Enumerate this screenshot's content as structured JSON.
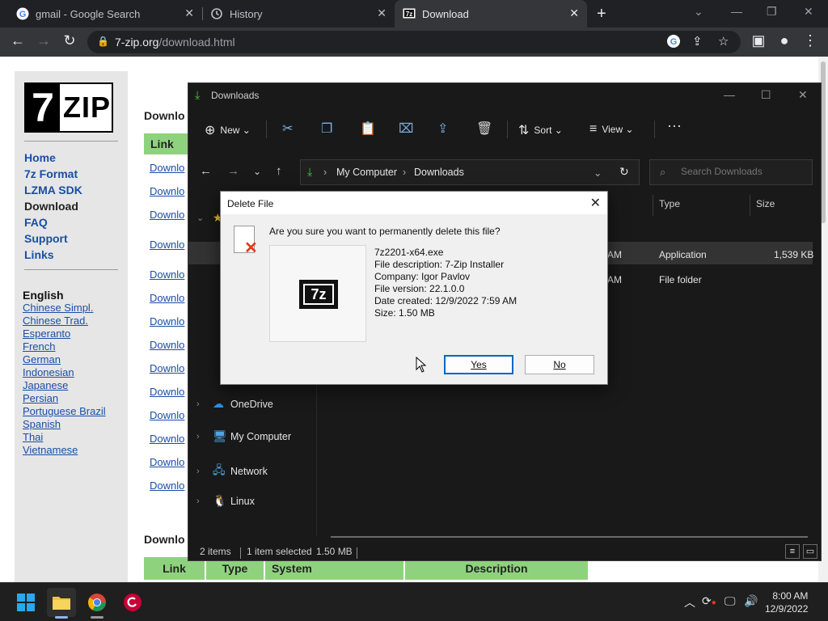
{
  "chrome": {
    "tabs": [
      {
        "title": "gmail - Google Search",
        "icon": "google-g-icon"
      },
      {
        "title": "History",
        "icon": "history-icon"
      },
      {
        "title": "Download",
        "icon": "7zip-favicon"
      }
    ],
    "url_host": "7-zip.org",
    "url_path": "/download.html"
  },
  "site": {
    "nav": [
      "Home",
      "7z Format",
      "LZMA SDK",
      "Download",
      "FAQ",
      "Support",
      "Links"
    ],
    "current_nav": "Download",
    "language_heading": "English",
    "languages": [
      "Chinese Simpl.",
      "Chinese Trad.",
      "Esperanto",
      "French",
      "German",
      "Indonesian",
      "Japanese",
      "Persian",
      "Portuguese Brazil",
      "Spanish",
      "Thai",
      "Vietnamese"
    ],
    "section_heading_1": "Downlo",
    "section_heading_2": "Downlo",
    "link_header": "Link",
    "download_link": "Downlo",
    "table_headers": [
      "Link",
      "Type",
      "System",
      "Description"
    ]
  },
  "explorer": {
    "title": "Downloads",
    "commands": {
      "new": "New",
      "sort": "Sort",
      "view": "View"
    },
    "breadcrumb": [
      "My Computer",
      "Downloads"
    ],
    "search_placeholder": "Search Downloads",
    "columns": {
      "type": "Type",
      "size": "Size"
    },
    "rows": [
      {
        "time_fragment": "AM",
        "type": "Application",
        "size": "1,539 KB"
      },
      {
        "time_fragment": "AM",
        "type": "File folder",
        "size": ""
      }
    ],
    "nav_items": [
      "OneDrive",
      "My Computer",
      "Network",
      "Linux"
    ],
    "status": {
      "items": "2 items",
      "selected": "1 item selected",
      "size": "1.50 MB"
    }
  },
  "dialog": {
    "title": "Delete File",
    "question": "Are you sure you want to permanently delete this file?",
    "file_name": "7z2201-x64.exe",
    "description": "File description: 7-Zip Installer",
    "company": "Company: Igor Pavlov",
    "version": "File version: 22.1.0.0",
    "date": "Date created: 12/9/2022 7:59 AM",
    "size": "Size: 1.50 MB",
    "yes": "Yes",
    "no": "No",
    "logo_text": "7z"
  },
  "taskbar": {
    "time": "8:00 AM",
    "date": "12/9/2022"
  },
  "colors": {
    "accent": "#0067c0",
    "site_green": "#8fd27e",
    "link": "#1a4ea3"
  }
}
